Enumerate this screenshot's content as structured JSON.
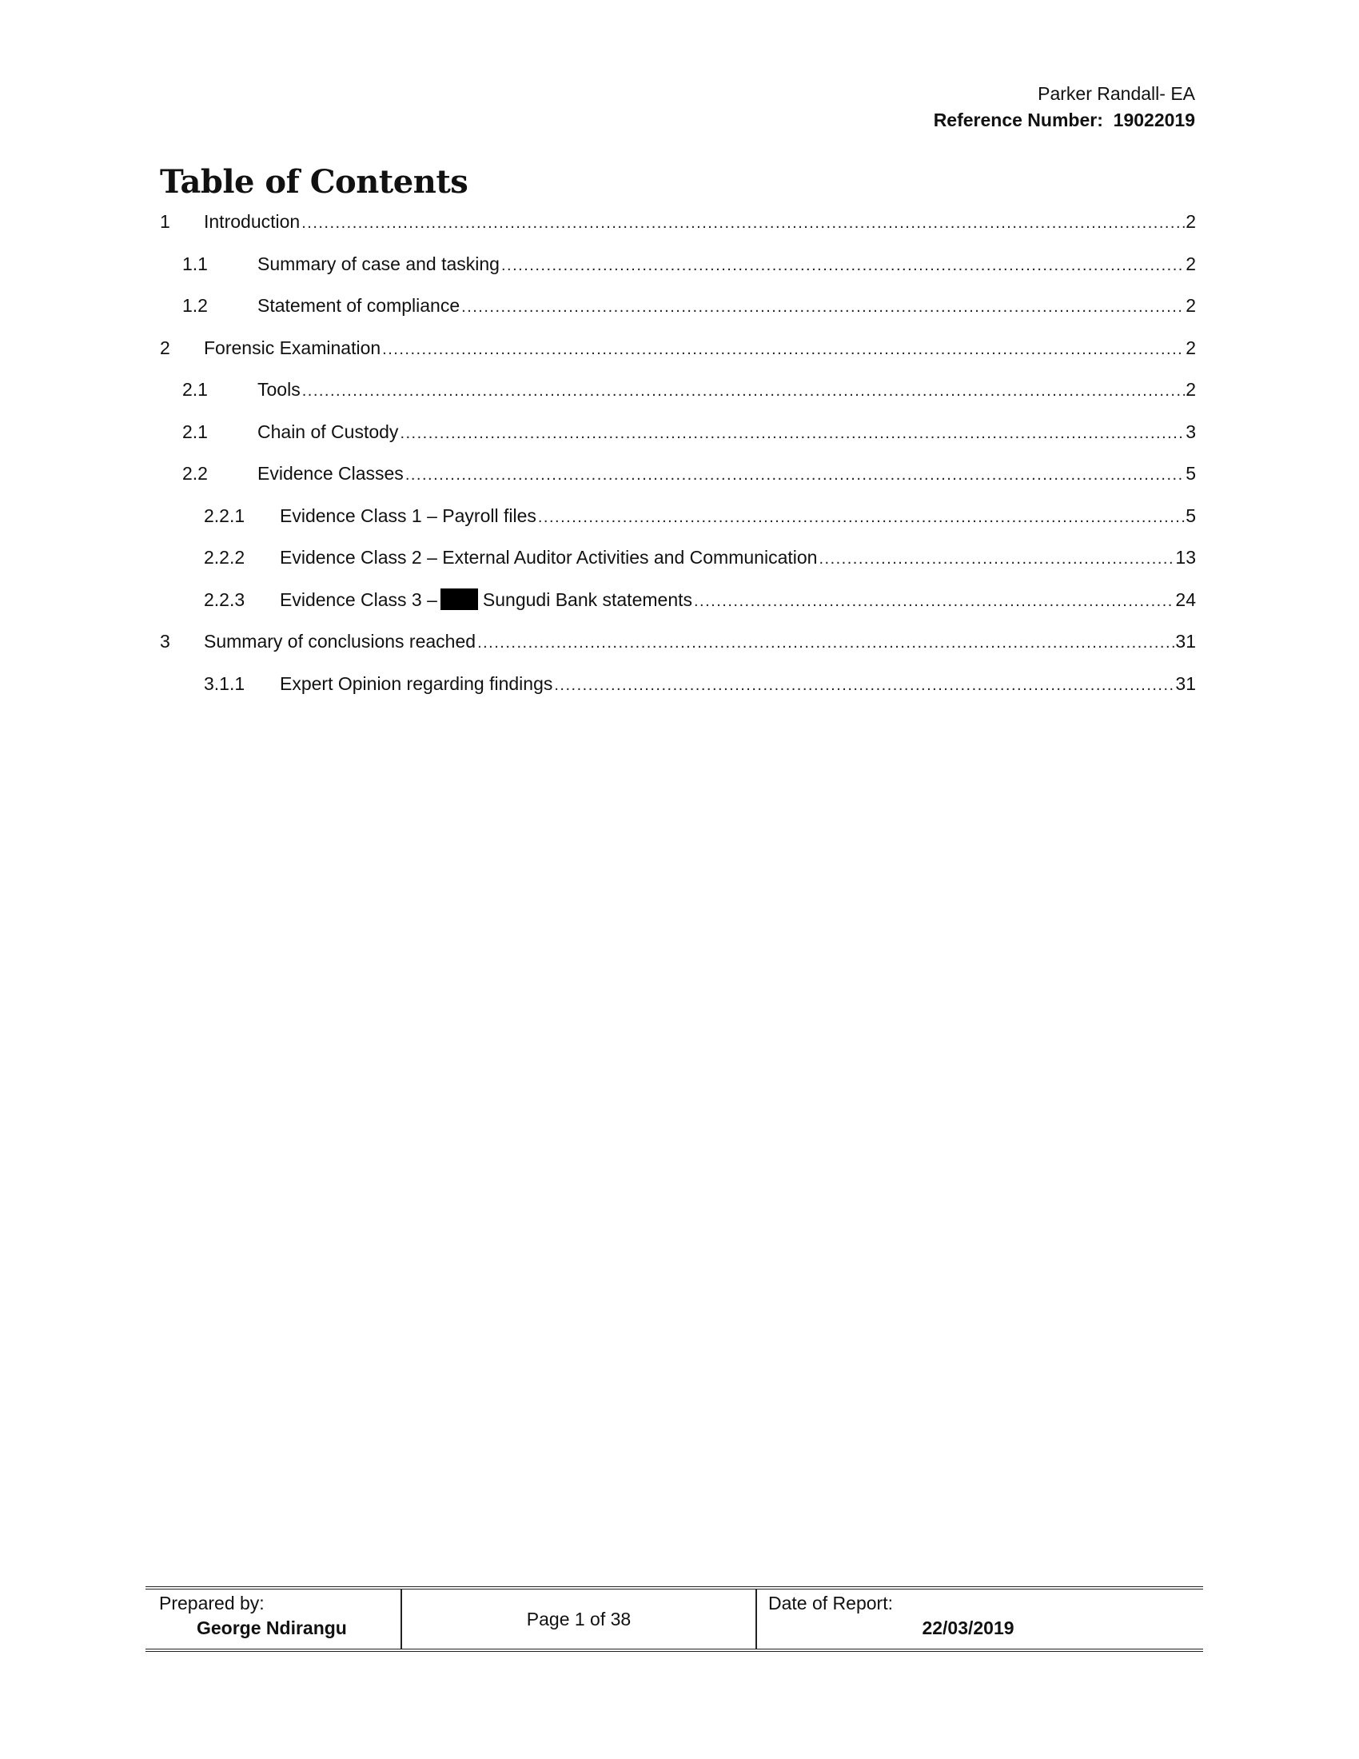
{
  "header": {
    "organization": "Parker Randall- EA",
    "reference_label": "Reference Number:",
    "reference_number": "19022019"
  },
  "toc": {
    "title": "Table of Contents",
    "entries": [
      {
        "num": "1",
        "label": "Introduction",
        "page": "2",
        "level": 1
      },
      {
        "num": "1.1",
        "label": "Summary of case and tasking",
        "page": "2",
        "level": 2
      },
      {
        "num": "1.2",
        "label": "Statement of compliance",
        "page": "2",
        "level": 2
      },
      {
        "num": "2",
        "label": "Forensic Examination",
        "page": "2",
        "level": 1
      },
      {
        "num": "2.1",
        "label": "Tools",
        "page": "2",
        "level": 2
      },
      {
        "num": "2.1",
        "label": "Chain of Custody",
        "page": "3",
        "level": 2
      },
      {
        "num": "2.2",
        "label": "Evidence Classes",
        "page": "5",
        "level": 2
      },
      {
        "num": "2.2.1",
        "label": "Evidence Class 1 – Payroll files",
        "page": "5",
        "level": 3
      },
      {
        "num": "2.2.2",
        "label": "Evidence Class 2 – External Auditor Activities and Communication",
        "page": "13",
        "level": 3
      },
      {
        "num": "2.2.3",
        "label_before": "Evidence Class 3 –",
        "label_after": "Sungudi Bank statements",
        "redacted": true,
        "page": "24",
        "level": 3
      },
      {
        "num": "3",
        "label": "Summary of conclusions reached",
        "page": "31",
        "level": 1
      },
      {
        "num": "3.1.1",
        "label": "Expert Opinion regarding findings",
        "page": "31",
        "level": 3
      }
    ]
  },
  "footer": {
    "prepared_by_label": "Prepared by:",
    "prepared_by_name": "George Ndirangu",
    "page_indicator": "Page 1 of 38",
    "date_label": "Date of Report:",
    "date_value": "22/03/2019"
  },
  "colors": {
    "text": "#111111",
    "redaction": "#000000",
    "background": "#ffffff"
  }
}
